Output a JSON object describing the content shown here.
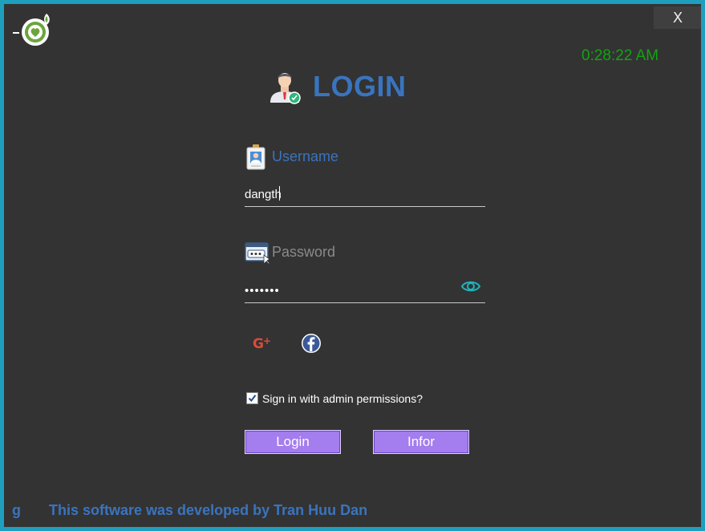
{
  "window": {
    "close_label": "X",
    "clock": "0:28:22 AM",
    "title": "LOGIN"
  },
  "form": {
    "username_label": "Username",
    "username_value": "dangth",
    "password_label": "Password",
    "password_masked": "•••••••",
    "admin_checkbox_label": "Sign in with admin permissions?",
    "admin_checked": true,
    "login_button": "Login",
    "infor_button": "Infor"
  },
  "social": {
    "google_icon": "google-plus-icon",
    "facebook_icon": "facebook-icon"
  },
  "footer": {
    "left_char": "g",
    "credit": "This software was developed by Tran Huu Dan"
  },
  "colors": {
    "border": "#1d9fbd",
    "background": "#333333",
    "title": "#3a74bf",
    "clock": "#12a412",
    "button": "#a47dee",
    "eye": "#1fb3bd"
  }
}
